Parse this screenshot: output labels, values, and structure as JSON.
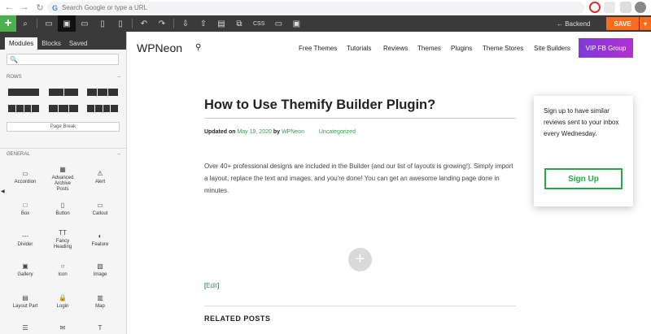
{
  "browser": {
    "back": "←",
    "forward": "→",
    "reload": "↻",
    "omnibox_placeholder": "Search Google or type a URL",
    "g_logo": "G"
  },
  "toolbar": {
    "add": "+",
    "css_label": "CSS",
    "backend_label": "← Backend",
    "save_label": "SAVE",
    "save_menu": "▾"
  },
  "panel": {
    "tabs": [
      "Modules",
      "Blocks",
      "Saved"
    ],
    "search_icon": "🔍",
    "rows_label": "ROWS",
    "page_break": "Page Break",
    "general_label": "GENERAL",
    "collapse": "–",
    "modules": [
      {
        "label": "Accordion",
        "icon": "▭"
      },
      {
        "label": "Advanced Archive Posts",
        "icon": "▦"
      },
      {
        "label": "Alert",
        "icon": "⚠"
      },
      {
        "label": "Box",
        "icon": "□"
      },
      {
        "label": "Button",
        "icon": "▯"
      },
      {
        "label": "Callout",
        "icon": "▭"
      },
      {
        "label": "Divider",
        "icon": "---"
      },
      {
        "label": "Fancy Heading",
        "icon": "TT"
      },
      {
        "label": "Feature",
        "icon": "◐"
      },
      {
        "label": "Gallery",
        "icon": "▣"
      },
      {
        "label": "Icon",
        "icon": "○"
      },
      {
        "label": "Image",
        "icon": "▨"
      },
      {
        "label": "Layout Part",
        "icon": "▤"
      },
      {
        "label": "Login",
        "icon": "🔒"
      },
      {
        "label": "Map",
        "icon": "▥"
      },
      {
        "label": "",
        "icon": "☰"
      },
      {
        "label": "",
        "icon": "✉"
      },
      {
        "label": "",
        "icon": "T"
      }
    ],
    "side_arrow": "◀"
  },
  "site": {
    "logo": "WPNeon",
    "search_icon": "⚲",
    "nav": [
      "Free Themes",
      "Tutorials",
      "Reviews",
      "Themes",
      "Plugins",
      "Theme Stores",
      "Site Builders"
    ],
    "vip": "VIP FB Group"
  },
  "post": {
    "title": "How to Use Themify Builder Plugin?",
    "meta_updated": "Updated on",
    "meta_date": "May 19, 2020",
    "meta_by": "by",
    "meta_author": "WPNeon",
    "meta_category": "Uncategorized",
    "body": "Over 40+ professional designs are included in the Builder (and our list of layouts is growing!). Simply import a layout, replace the text and images, and you're done! You can get an awesome landing page done in minutes.",
    "add_icon": "+",
    "edit_open": "[",
    "edit": "Edit",
    "edit_close": "]",
    "related": "RELATED POSTS"
  },
  "signup": {
    "text": "Sign up to have similar reviews sent to your inbox every Wednesday.",
    "button": "Sign Up"
  },
  "colors": {
    "accent_green": "#28a745",
    "save_orange": "#ff6b1a",
    "toolbar_dark": "#3a3a3a"
  }
}
